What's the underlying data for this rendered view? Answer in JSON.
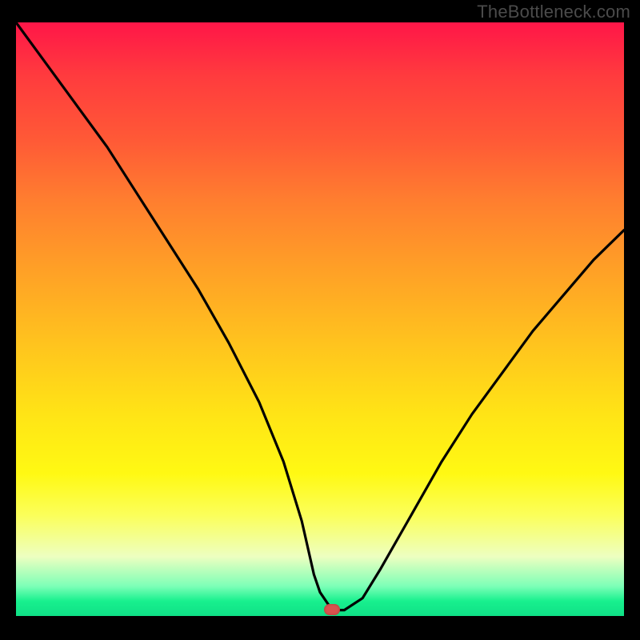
{
  "watermark": "TheBottleneck.com",
  "colors": {
    "background": "#000000",
    "gradient_top": "#ff1648",
    "gradient_mid": "#ffe416",
    "gradient_bottom": "#18f08e",
    "marker": "#d9534f",
    "curve": "#000000"
  },
  "chart_data": {
    "type": "line",
    "title": "",
    "xlabel": "",
    "ylabel": "",
    "xlim": [
      0,
      100
    ],
    "ylim": [
      0,
      100
    ],
    "grid": false,
    "legend": false,
    "marker": {
      "x": 52,
      "y": 1,
      "shape": "rounded-rect"
    },
    "series": [
      {
        "name": "bottleneck-curve",
        "x": [
          0,
          5,
          10,
          15,
          20,
          25,
          30,
          35,
          40,
          44,
          47,
          49,
          50,
          52,
          54,
          57,
          60,
          65,
          70,
          75,
          80,
          85,
          90,
          95,
          100
        ],
        "y": [
          100,
          93,
          86,
          79,
          71,
          63,
          55,
          46,
          36,
          26,
          16,
          7,
          4,
          1,
          1,
          3,
          8,
          17,
          26,
          34,
          41,
          48,
          54,
          60,
          65
        ]
      }
    ],
    "notes": "V-shaped curve; left branch descends steeply from top-left (100) to a short flat trough near x≈50–52, y≈1; right branch rises more gently toward ≈65 at the right edge."
  }
}
